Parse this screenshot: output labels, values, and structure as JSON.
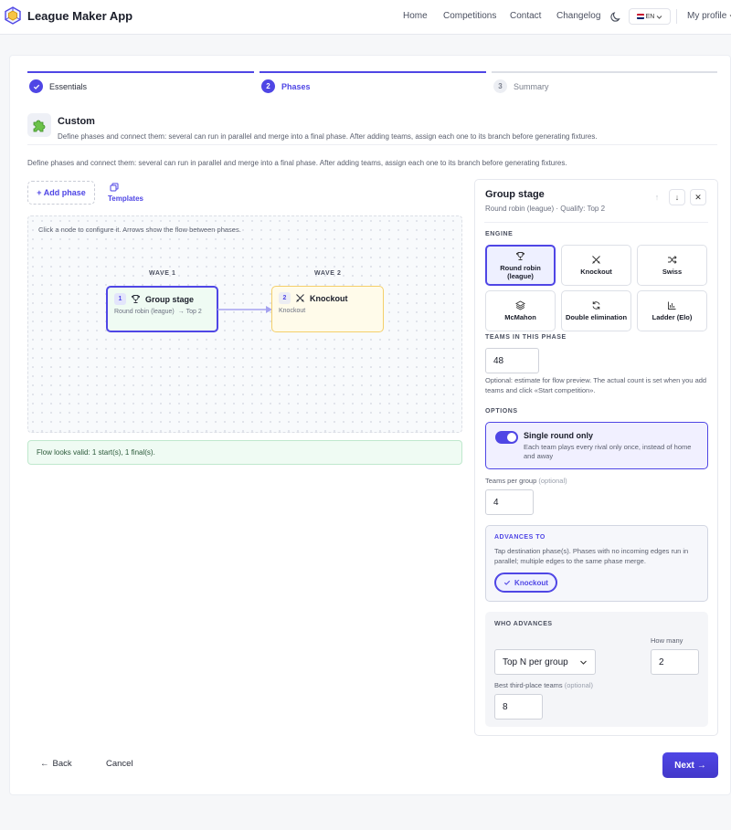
{
  "header": {
    "app_title": "League Maker App",
    "nav": [
      {
        "label": "Home"
      },
      {
        "label": "Competitions"
      },
      {
        "label": "Contact"
      },
      {
        "label": "Changelog"
      }
    ],
    "language": "EN",
    "profile": "My profile"
  },
  "stepper": {
    "steps": [
      {
        "number": "1",
        "label": "Essentials",
        "state": "done"
      },
      {
        "number": "2",
        "label": "Phases",
        "state": "active"
      },
      {
        "number": "3",
        "label": "Summary",
        "state": "upcoming"
      }
    ]
  },
  "custom": {
    "title": "Custom",
    "description": "Define phases and connect them: several can run in parallel and merge into a final phase. After adding teams, assign each one to its branch before generating fixtures."
  },
  "intro_text": "Define phases and connect them: several can run in parallel and merge into a final phase. After adding teams, assign each one to its branch before generating fixtures.",
  "toolbar": {
    "add_phase": "+ Add phase",
    "templates": "Templates"
  },
  "flow": {
    "hint": "Click a node to configure it. Arrows show the flow between phases.",
    "waves": [
      "WAVE 1",
      "WAVE 2"
    ],
    "nodes": [
      {
        "number": "1",
        "title": "Group stage",
        "engine": "Round robin (league)",
        "qualify": "→ Top 2"
      },
      {
        "number": "2",
        "title": "Knockout",
        "engine": "Knockout",
        "qualify": ""
      }
    ],
    "validation": "Flow looks valid: 1 start(s), 1 final(s)."
  },
  "panel": {
    "title": "Group stage",
    "subtitle": "Round robin (league) · Qualify: Top 2",
    "engine_label": "ENGINE",
    "engines": [
      {
        "label": "Round robin (league)",
        "icon": "trophy-icon",
        "selected": true
      },
      {
        "label": "Knockout",
        "icon": "swords-icon",
        "selected": false
      },
      {
        "label": "Swiss",
        "icon": "shuffle-icon",
        "selected": false
      },
      {
        "label": "McMahon",
        "icon": "layers-icon",
        "selected": false
      },
      {
        "label": "Double elimination",
        "icon": "refresh-icon",
        "selected": false
      },
      {
        "label": "Ladder (Elo)",
        "icon": "bar-chart-icon",
        "selected": false
      }
    ],
    "teams_label": "TEAMS IN THIS PHASE",
    "teams_value": "48",
    "teams_help": "Optional: estimate for flow preview. The actual count is set when you add teams and click «Start competition».",
    "options_label": "OPTIONS",
    "single_round": {
      "title": "Single round only",
      "description": "Each team plays every rival only once, instead of home and away",
      "enabled": true
    },
    "teams_per_group_label": "Teams per group",
    "optional_text": "(optional)",
    "teams_per_group_value": "4",
    "advances_to": {
      "label": "ADVANCES TO",
      "description": "Tap destination phase(s). Phases with no incoming edges run in parallel; multiple edges to the same phase merge.",
      "target": "Knockout"
    },
    "who_advances": {
      "label": "WHO ADVANCES",
      "how_many_label": "How many",
      "mode": "Top N per group",
      "how_many_value": "2",
      "best_third_label": "Best third-place teams",
      "best_third_optional": "(optional)",
      "best_third_value": "8"
    }
  },
  "footer": {
    "back": "Back",
    "cancel": "Cancel",
    "next": "Next"
  },
  "colors": {
    "accent": "#4f46e5",
    "group_node_bg": "#effbf3",
    "knockout_node_bg": "#fffbea",
    "valid_bg": "#effbf3"
  }
}
